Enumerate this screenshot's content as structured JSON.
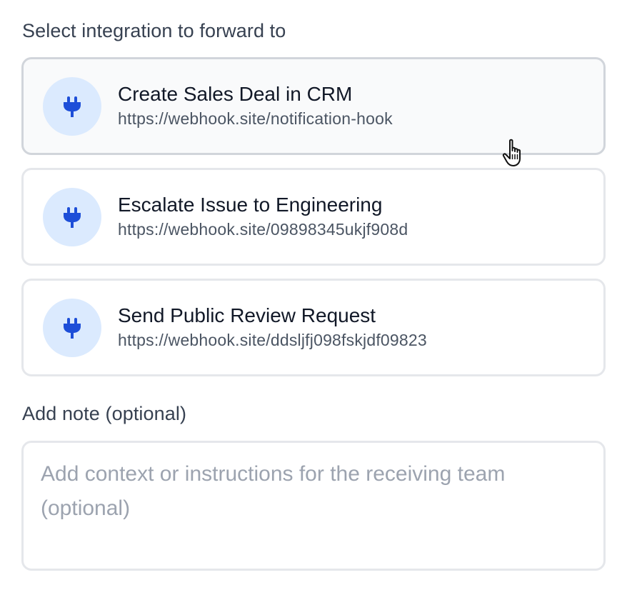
{
  "integrations": {
    "heading": "Select integration to forward to",
    "items": [
      {
        "title": "Create Sales Deal in CRM",
        "url": "https://webhook.site/notification-hook",
        "icon": "plug-icon",
        "state": "hovered"
      },
      {
        "title": "Escalate Issue to Engineering",
        "url": "https://webhook.site/09898345ukjf908d",
        "icon": "plug-icon",
        "state": "default"
      },
      {
        "title": "Send Public Review Request",
        "url": "https://webhook.site/ddsljfj098fskjdf09823",
        "icon": "plug-icon",
        "state": "default"
      }
    ]
  },
  "note": {
    "label": "Add note (optional)",
    "value": "",
    "placeholder": "Add context or instructions for the receiving team (optional)"
  },
  "colors": {
    "icon_bg": "#dbeafe",
    "icon_fg": "#1d4ed8",
    "card_border": "#e5e7eb",
    "hover_bg": "#f9fafb",
    "placeholder": "#9ca3af"
  }
}
